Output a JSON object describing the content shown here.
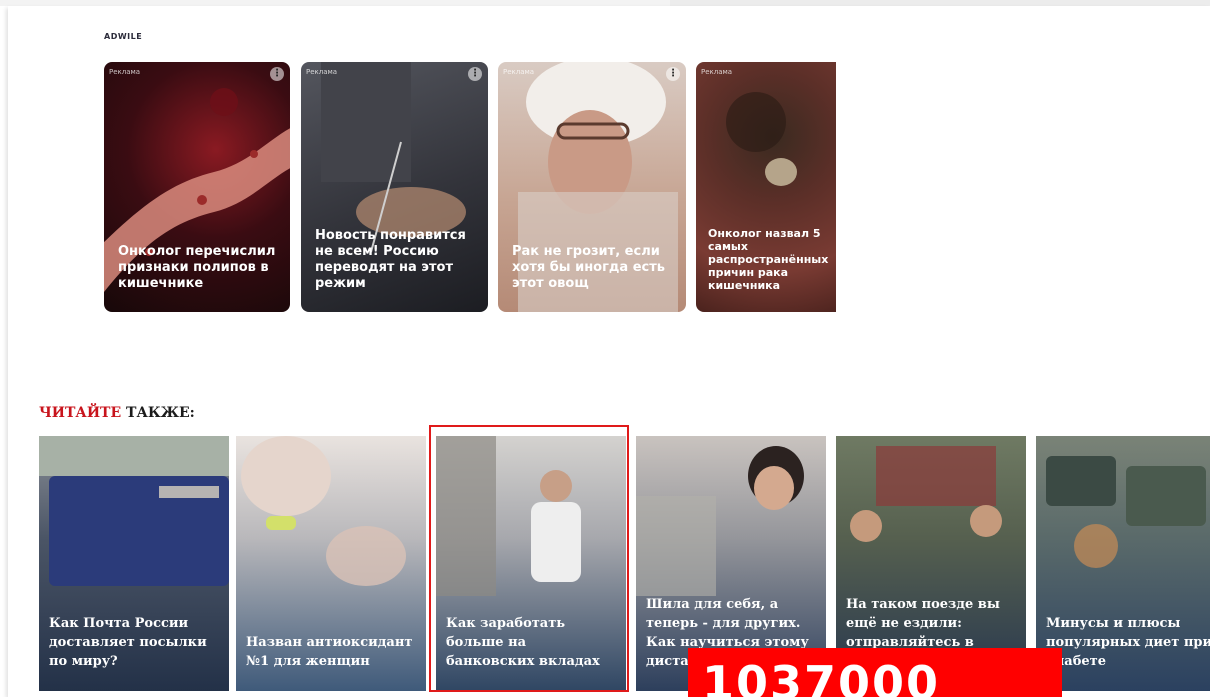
{
  "brand": "ADWILE",
  "ads": [
    {
      "label": "Реклама",
      "title": "Онколог перечислил признаки полипов в кишечнике"
    },
    {
      "label": "Реклама",
      "title": "Новость понравится не всем! Россию переводят на этот режим"
    },
    {
      "label": "Реклама",
      "title": "Рак не грозит, если хотя бы иногда есть этот овощ"
    },
    {
      "label": "Реклама",
      "title": "Онколог назвал 5 самых распространённых причин рака кишечника"
    }
  ],
  "section": {
    "accent": "ЧИТАЙТЕ",
    "rest": " ТАКЖЕ:"
  },
  "cards": [
    {
      "title": "Как Почта России доставляет посылки по миру?"
    },
    {
      "title": "Назван антиоксидант №1 для женщин"
    },
    {
      "title": "Как заработать больше на банковских вкладах"
    },
    {
      "title": "Шила для себя, а теперь - для других. Как научиться этому дистанционно"
    },
    {
      "title": "На таком поезде вы ещё не ездили: отправляйтесь в путешествие на"
    },
    {
      "title": "Минусы и плюсы популярных диет при диабете"
    }
  ],
  "counter": "1037000",
  "colors": {
    "accent": "#c8141c",
    "counter_bg": "#ff0000"
  }
}
